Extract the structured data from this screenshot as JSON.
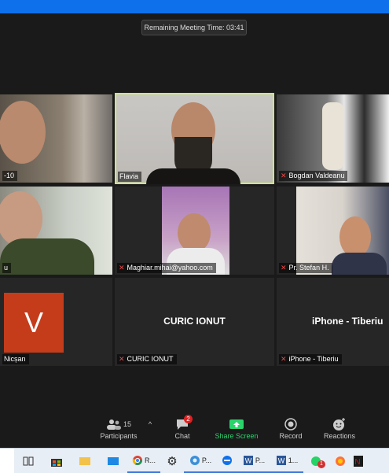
{
  "meeting": {
    "remaining_time": "Remaining Meeting Time: 03:41"
  },
  "tiles": {
    "t1": {
      "name": "-10"
    },
    "t2": {
      "name": "Flavia"
    },
    "t3": {
      "name": "Bogdan Valdeanu"
    },
    "t4": {
      "name": "u"
    },
    "t5": {
      "name": "Maghiar.mihai@yahoo.com"
    },
    "t6": {
      "name": "Pr. Stefan H."
    },
    "t7": {
      "name": "Nicșan",
      "avatar_letter": "V",
      "avatar_color": "#c53c1b"
    },
    "t8": {
      "name": "CURIC IONUT",
      "display": "CURIC IONUT"
    },
    "t9": {
      "name": "iPhone - Tiberiu",
      "display": "iPhone - Tiberiu"
    }
  },
  "controls": {
    "participants_count": "15",
    "participants_label": "Participants",
    "chat_label": "Chat",
    "chat_badge": "2",
    "share_label": "Share Screen",
    "record_label": "Record",
    "reactions_label": "Reactions"
  },
  "taskbar": {
    "items": [
      "R...",
      "P...",
      "P...",
      "1...",
      "1"
    ]
  },
  "colors": {
    "accent": "#0e71eb",
    "active_speaker": "#c9e87a",
    "share": "#2ad46b",
    "muted": "#e24a4a"
  }
}
